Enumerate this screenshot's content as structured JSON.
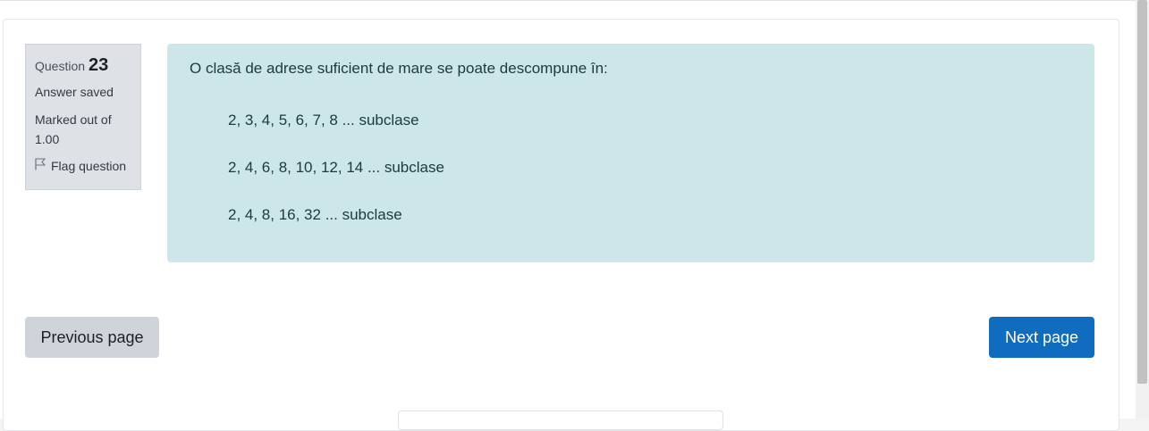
{
  "question_info": {
    "label": "Question",
    "number": "23",
    "state": "Answer saved",
    "grade": "Marked out of 1.00",
    "flag_label": "Flag question",
    "flag_icon": "flag-icon"
  },
  "question": {
    "text": "O clasă de adrese suficient de mare se poate descompune în:",
    "answers": [
      "2, 3, 4, 5, 6, 7, 8 ... subclase",
      "2, 4, 6, 8, 10, 12, 14 ... subclase",
      "2, 4, 8, 16, 32 ... subclase"
    ]
  },
  "navigation": {
    "previous_label": "Previous page",
    "next_label": "Next page"
  },
  "colors": {
    "formulation_bg": "#cce6ea",
    "info_bg": "#dee2e6",
    "primary": "#0f6cbf",
    "secondary": "#ced4da"
  }
}
